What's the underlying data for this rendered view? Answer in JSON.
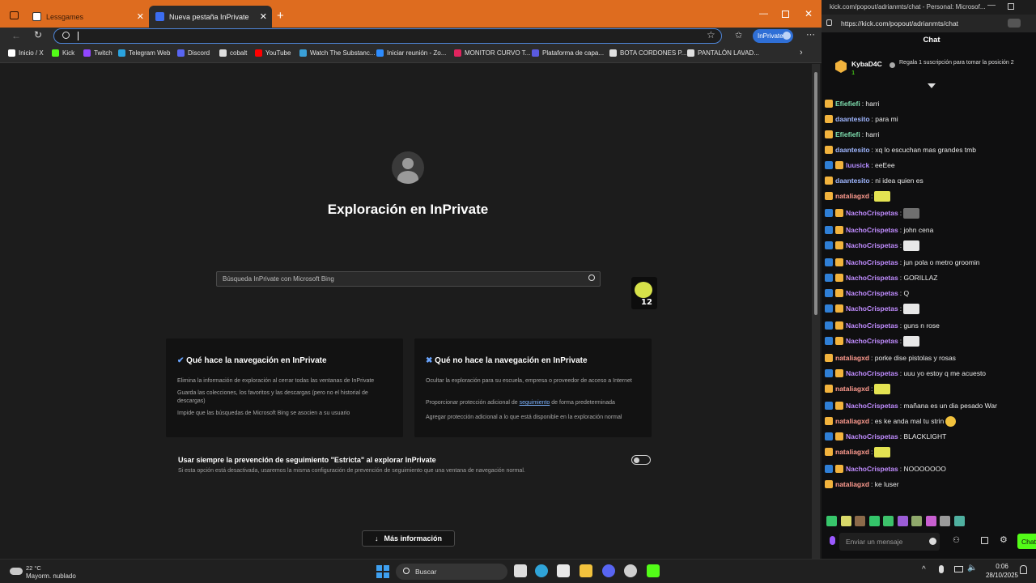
{
  "browser": {
    "tabs": [
      {
        "label": "Lessgames",
        "active": false
      },
      {
        "label": "Nueva pestaña InPrivate",
        "active": true
      }
    ],
    "inprivate_badge": "InPrivate",
    "bookmarks": [
      {
        "label": "Inicio / X",
        "icon": "x-icon",
        "color": "#ffffff"
      },
      {
        "label": "Kick",
        "icon": "kick-icon",
        "color": "#53fc18"
      },
      {
        "label": "Twitch",
        "icon": "twitch-icon",
        "color": "#9146ff"
      },
      {
        "label": "Telegram Web",
        "icon": "telegram-icon",
        "color": "#2aa3df"
      },
      {
        "label": "Discord",
        "icon": "discord-icon",
        "color": "#5865f2"
      },
      {
        "label": "cobalt",
        "icon": "cobalt-icon",
        "color": "#dddddd"
      },
      {
        "label": "YouTube",
        "icon": "youtube-icon",
        "color": "#ff0000"
      },
      {
        "label": "Watch The Substanc...",
        "icon": "movie-icon",
        "color": "#3aa0d8"
      },
      {
        "label": "Iniciar reunión - Zo...",
        "icon": "zoom-icon",
        "color": "#2d8cff"
      },
      {
        "label": "MONITOR CURVO T...",
        "icon": "store-icon",
        "color": "#e0245e"
      },
      {
        "label": "Plataforma de capa...",
        "icon": "platform-icon",
        "color": "#5a5ae0"
      },
      {
        "label": "BOTA CORDONES P...",
        "icon": "shop-icon",
        "color": "#e0e0e0"
      },
      {
        "label": "PANTALÓN LAVAD...",
        "icon": "shop-icon",
        "color": "#e0e0e0"
      }
    ],
    "page": {
      "heading": "Exploración en InPrivate",
      "search_placeholder": "Búsqueda InPrivate con Microsoft Bing",
      "card_does": {
        "title": "Qué hace la navegación en InPrivate",
        "items": [
          "Elimina la información de exploración al cerrar todas las ventanas de InPrivate",
          "Guarda las colecciones, los favoritos y las descargas (pero no el historial de descargas)",
          "Impide que las búsquedas de Microsoft Bing se asocien a su usuario"
        ]
      },
      "card_doesnt": {
        "title": "Qué no hace la navegación en InPrivate",
        "items": [
          "Ocultar la exploración para su escuela, empresa o proveedor de acceso a Internet",
          "Agregar protección adicional a lo que está disponible en la exploración normal"
        ],
        "item_link_pre": "Proporcionar protección adicional de ",
        "item_link": "seguimiento",
        "item_link_post": " de forma predeterminada"
      },
      "strict_title": "Usar siempre la prevención de seguimiento \"Estricta\" al explorar InPrivate",
      "strict_desc": "Si esta opción está desactivada, usaremos la misma configuración de prevención de seguimiento que una ventana de navegación normal.",
      "strict_toggle": "off",
      "more_info": "Más información"
    }
  },
  "chat": {
    "url": "https://kick.com/popout/adrianmts/chat",
    "titlebar": "kick.com/popout/adrianmts/chat - Personal: Microsof...",
    "title": "Chat",
    "pinned": {
      "user": "KybaD4C",
      "count": "1",
      "message": "Regala 1 suscripción para tomar la posición 2"
    },
    "messages": [
      {
        "user": "Efiefiefi",
        "color": "#7fe0b0",
        "sub": false,
        "text": ": harri",
        "emote": ""
      },
      {
        "user": "daantesito",
        "color": "#9fb6ff",
        "sub": false,
        "text": ": para mi",
        "emote": ""
      },
      {
        "user": "Efiefiefi",
        "color": "#7fe0b0",
        "sub": false,
        "text": ": harri",
        "emote": ""
      },
      {
        "user": "daantesito",
        "color": "#9fb6ff",
        "sub": false,
        "text": ": xq lo escuchan mas grandes tmb",
        "emote": ""
      },
      {
        "user": "luusick",
        "color": "#b48cff",
        "sub": true,
        "text": ": eeEee",
        "emote": ""
      },
      {
        "user": "daantesito",
        "color": "#9fb6ff",
        "sub": false,
        "text": ": ni idea quien es",
        "emote": ""
      },
      {
        "user": "nataliagxd",
        "color": "#ff9b8f",
        "sub": false,
        "text": ":",
        "emote": "car"
      },
      {
        "user": "NachoCrispetas",
        "color": "#c08cff",
        "sub": true,
        "text": ":",
        "emote": "face"
      },
      {
        "user": "NachoCrispetas",
        "color": "#c08cff",
        "sub": true,
        "text": ": john cena",
        "emote": ""
      },
      {
        "user": "NachoCrispetas",
        "color": "#c08cff",
        "sub": true,
        "text": ":",
        "emote": "meme"
      },
      {
        "user": "NachoCrispetas",
        "color": "#c08cff",
        "sub": true,
        "text": ": jun pola o metro groomin",
        "emote": ""
      },
      {
        "user": "NachoCrispetas",
        "color": "#c08cff",
        "sub": true,
        "text": ": GORILLAZ",
        "emote": ""
      },
      {
        "user": "NachoCrispetas",
        "color": "#c08cff",
        "sub": true,
        "text": ": Q",
        "emote": ""
      },
      {
        "user": "NachoCrispetas",
        "color": "#c08cff",
        "sub": true,
        "text": ":",
        "emote": "meme"
      },
      {
        "user": "NachoCrispetas",
        "color": "#c08cff",
        "sub": true,
        "text": ": guns n rose",
        "emote": ""
      },
      {
        "user": "NachoCrispetas",
        "color": "#c08cff",
        "sub": true,
        "text": ":",
        "emote": "meme"
      },
      {
        "user": "nataliagxd",
        "color": "#ff9b8f",
        "sub": false,
        "text": ": porke dise pistolas y rosas",
        "emote": ""
      },
      {
        "user": "NachoCrispetas",
        "color": "#c08cff",
        "sub": true,
        "text": ": uuu yo estoy q me acuesto",
        "emote": ""
      },
      {
        "user": "nataliagxd",
        "color": "#ff9b8f",
        "sub": false,
        "text": ":",
        "emote": "car"
      },
      {
        "user": "NachoCrispetas",
        "color": "#c08cff",
        "sub": true,
        "text": ": mañana es un dia pesado War",
        "emote": ""
      },
      {
        "user": "nataliagxd",
        "color": "#ff9b8f",
        "sub": false,
        "text": ": es ke anda mal tu strin",
        "emote": "smile"
      },
      {
        "user": "NachoCrispetas",
        "color": "#c08cff",
        "sub": true,
        "text": ": BLACKLIGHT",
        "emote": ""
      },
      {
        "user": "nataliagxd",
        "color": "#ff9b8f",
        "sub": false,
        "text": ":",
        "emote": "car"
      },
      {
        "user": "NachoCrispetas",
        "color": "#c08cff",
        "sub": true,
        "text": ": NOOOOOOO",
        "emote": ""
      },
      {
        "user": "nataliagxd",
        "color": "#ff9b8f",
        "sub": false,
        "text": ": ke luser",
        "emote": ""
      }
    ],
    "input_placeholder": "Enviar un mensaje",
    "send_label": "Chat"
  },
  "taskbar": {
    "weather_temp": "22 °C",
    "weather_desc": "Mayorm. nublado",
    "search_label": "Buscar",
    "time": "0:06",
    "date": "28/10/2025"
  },
  "colors": {
    "tabstrip": "#de6c1f",
    "kick_green": "#53fc18",
    "inprivate_blue": "#2f6fd6"
  }
}
